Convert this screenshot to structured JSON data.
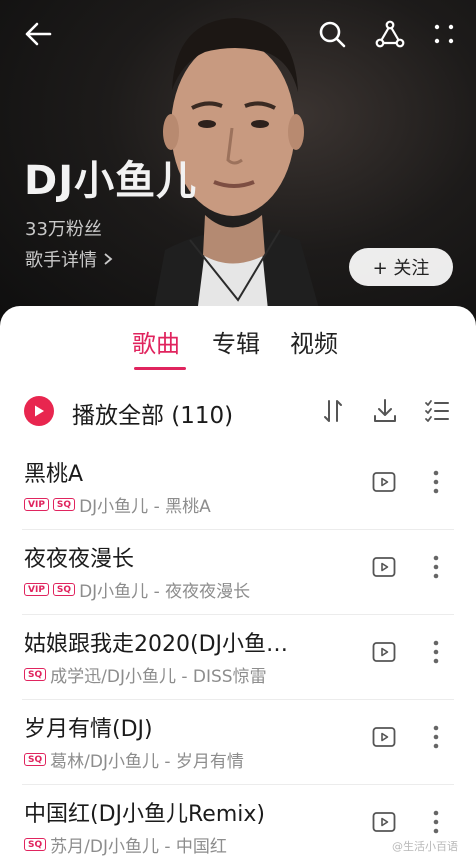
{
  "header": {
    "artist_name": "DJ小鱼儿",
    "fans": "33万粉丝",
    "detail_link": "歌手详情",
    "follow_label": "+ 关注",
    "icons": [
      "back-arrow-icon",
      "search-icon",
      "share-icon",
      "more-icon"
    ]
  },
  "tabs": [
    {
      "label": "歌曲",
      "active": true
    },
    {
      "label": "专辑",
      "active": false
    },
    {
      "label": "视频",
      "active": false
    }
  ],
  "play_all": {
    "label": "播放全部 (110)"
  },
  "songs": [
    {
      "title": "黑桃A",
      "badges": [
        "VIP",
        "SQ"
      ],
      "subtitle": "DJ小鱼儿 - 黑桃A"
    },
    {
      "title": "夜夜夜漫长",
      "badges": [
        "VIP",
        "SQ"
      ],
      "subtitle": "DJ小鱼儿 - 夜夜夜漫长"
    },
    {
      "title": "姑娘跟我走2020(DJ小鱼…",
      "badges": [
        "SQ"
      ],
      "subtitle": "成学迅/DJ小鱼儿 - DISS惊雷"
    },
    {
      "title": "岁月有情(DJ)",
      "badges": [
        "SQ"
      ],
      "subtitle": "葛林/DJ小鱼儿 - 岁月有情"
    },
    {
      "title": "中国红(DJ小鱼儿Remix)",
      "badges": [
        "SQ"
      ],
      "subtitle": "苏月/DJ小鱼儿 - 中国红"
    }
  ],
  "watermark": "@生活小百语",
  "colors": {
    "accent": "#e0245e",
    "play_all": "#e8264f"
  }
}
